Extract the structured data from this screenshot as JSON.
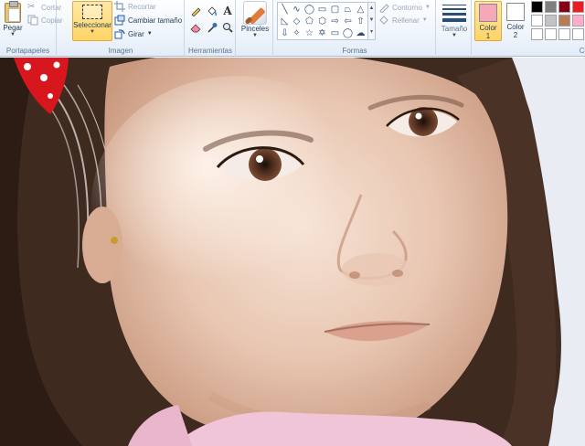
{
  "ribbon": {
    "clipboard": {
      "label": "Portapapeles",
      "paste": "Pegar",
      "cut": "Cortar",
      "copy": "Copiar"
    },
    "image": {
      "label": "Imagen",
      "select": "Seleccionar",
      "crop": "Recortar",
      "resize": "Cambiar tamaño",
      "rotate": "Girar"
    },
    "tools": {
      "label": "Herramientas",
      "text_tool_glyph": "A"
    },
    "brushes": {
      "label": "Pinceles"
    },
    "shapes": {
      "label": "Formas",
      "outline": "Contorno",
      "fill": "Rellenar"
    },
    "size": {
      "label": "Tamaño"
    },
    "colors": {
      "color1_label": "Color",
      "color1_num": "1",
      "color2_label": "Color",
      "color2_num": "2",
      "group_label_partial": "Co",
      "color1_value": "#f7a8b8",
      "color2_value": "#ffffff",
      "palette": [
        "#000000",
        "#7f7f7f",
        "#880015",
        "#ed1c24",
        "#ffffff",
        "#c3c3c3",
        "#b97a57",
        "#ffaec9",
        "#ffffff",
        "#ffffff",
        "#ffffff",
        "#ffffff"
      ]
    }
  },
  "canvas": {
    "content": "photo"
  }
}
